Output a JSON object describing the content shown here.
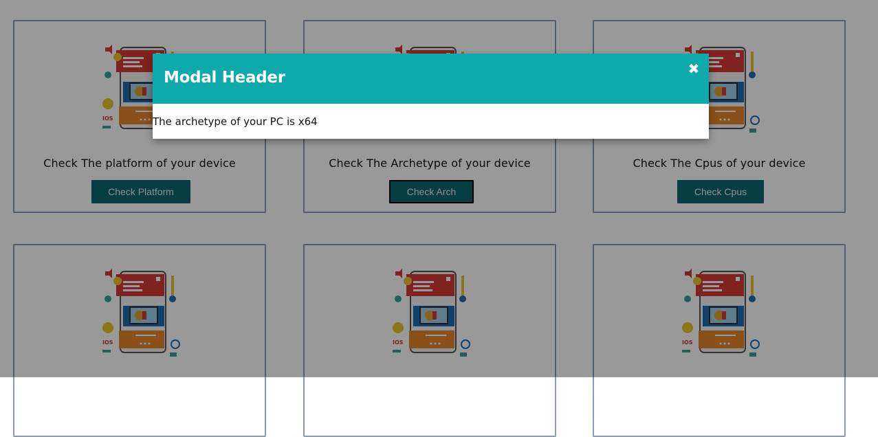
{
  "cards": [
    {
      "caption": "Check The platform of your device",
      "button": "Check Platform"
    },
    {
      "caption": "Check The Archetype of your device",
      "button": "Check Arch"
    },
    {
      "caption": "Check The Cpus of your device",
      "button": "Check Cpus"
    },
    {
      "caption": "",
      "button": ""
    },
    {
      "caption": "",
      "button": ""
    },
    {
      "caption": "",
      "button": ""
    }
  ],
  "illustration": {
    "ios_label": "IOS",
    "code_tag": "</>"
  },
  "modal": {
    "title": "Modal Header",
    "close_icon": "✖",
    "body": "The archetype of your PC is x64"
  },
  "colors": {
    "button_bg": "#0b6572",
    "modal_header": "#0ea9aa",
    "card_border": "#8a9ab8"
  }
}
